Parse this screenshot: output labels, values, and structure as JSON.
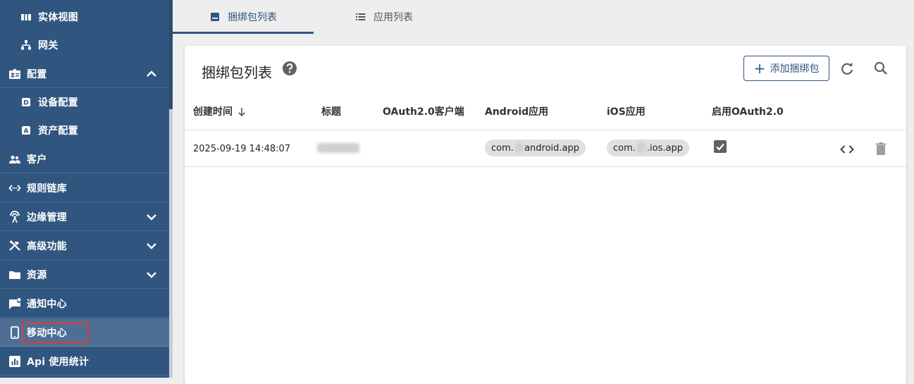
{
  "sidebar": {
    "items": [
      {
        "label": "实体视图",
        "icon": "entity-view-icon"
      },
      {
        "label": "网关",
        "icon": "gateway-icon"
      },
      {
        "label": "配置",
        "icon": "profiles-icon"
      },
      {
        "label": "设备配置",
        "icon": "device-profile-icon"
      },
      {
        "label": "资产配置",
        "icon": "asset-profile-icon"
      },
      {
        "label": "客户",
        "icon": "customers-icon"
      },
      {
        "label": "规则链库",
        "icon": "rule-chain-icon"
      },
      {
        "label": "边缘管理",
        "icon": "edge-icon"
      },
      {
        "label": "高级功能",
        "icon": "tools-icon"
      },
      {
        "label": "资源",
        "icon": "folder-icon"
      },
      {
        "label": "通知中心",
        "icon": "notification-icon"
      },
      {
        "label": "移动中心",
        "icon": "mobile-icon"
      },
      {
        "label": "Api 使用统计",
        "icon": "api-usage-icon"
      }
    ],
    "active_item": "移动中心"
  },
  "tabs": [
    {
      "label": "捆绑包列表",
      "icon": "bundle-icon",
      "active": true
    },
    {
      "label": "应用列表",
      "icon": "list-icon",
      "active": false
    }
  ],
  "card": {
    "title": "捆绑包列表",
    "add_button_label": "添加捆绑包"
  },
  "table": {
    "columns": [
      "创建时间",
      "标题",
      "OAuth2.0客户端",
      "Android应用",
      "iOS应用",
      "启用OAuth2.0"
    ],
    "rows": [
      {
        "created": "2025-09-19 14:48:07",
        "title": "",
        "oauth_client": "",
        "android_prefix": "com.",
        "android_suffix": "android.app",
        "ios_prefix": "com.",
        "ios_suffix": ".ios.app",
        "oauth_enabled": true
      }
    ]
  },
  "colors": {
    "sidebar_bg": "#305680",
    "accent": "#305680",
    "highlight_box": "#e53935"
  }
}
